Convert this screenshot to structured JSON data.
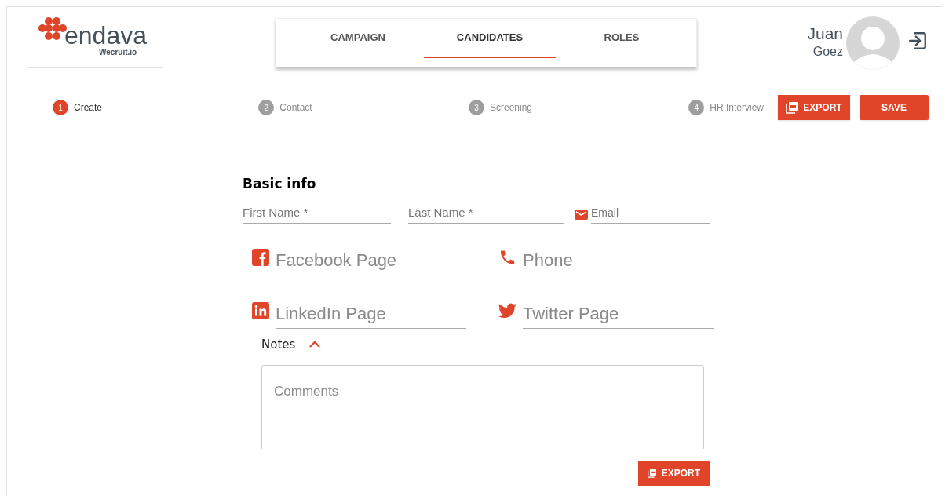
{
  "logo": {
    "name": "endava",
    "product": "Wecruit.io"
  },
  "tabs": [
    {
      "label": "CAMPAIGN",
      "selected": false
    },
    {
      "label": "CANDIDATES",
      "selected": true
    },
    {
      "label": "ROLES",
      "selected": false
    }
  ],
  "user": {
    "first_name": "Juan",
    "last_name": "Goez"
  },
  "steps": [
    {
      "number": "1",
      "label": "Create",
      "selected": true
    },
    {
      "number": "2",
      "label": "Contact",
      "selected": false
    },
    {
      "number": "3",
      "label": "Screening",
      "selected": false
    },
    {
      "number": "4",
      "label": "HR Interview",
      "selected": false
    }
  ],
  "header_buttons": [
    {
      "label": "EXPORT",
      "kind": "export"
    },
    {
      "label": "SAVE",
      "kind": "save"
    }
  ],
  "form": {
    "title": "Basic info",
    "name_fields": [
      {
        "placeholder": "First Name *"
      },
      {
        "placeholder": "Last Name *"
      },
      {
        "placeholder": "Email"
      }
    ],
    "contact_fields": [
      {
        "placeholder": "Facebook Page"
      },
      {
        "placeholder": "Phone"
      },
      {
        "placeholder": "LinkedIn Page"
      },
      {
        "placeholder": "Twitter Page"
      }
    ],
    "notes": {
      "label": "Notes",
      "expanded": true,
      "placeholder": "Comments"
    },
    "export_button": {
      "label": "EXPORT"
    }
  }
}
